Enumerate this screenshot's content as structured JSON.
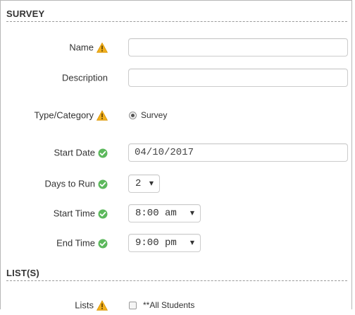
{
  "colors": {
    "warning": "#f2b01e",
    "ok": "#5cb85c",
    "border": "#cccccc"
  },
  "survey_section": {
    "title": "SURVEY",
    "name": {
      "label": "Name",
      "icon": "warning-icon",
      "value": ""
    },
    "description": {
      "label": "Description",
      "value": ""
    },
    "type": {
      "label": "Type/Category",
      "icon": "warning-icon",
      "option_label": "Survey",
      "selected": true
    },
    "start_date": {
      "label": "Start Date",
      "icon": "check-circle-icon",
      "value": "04/10/2017"
    },
    "days_to_run": {
      "label": "Days to Run",
      "icon": "check-circle-icon",
      "value": "2"
    },
    "start_time": {
      "label": "Start Time",
      "icon": "check-circle-icon",
      "value": "8:00 am"
    },
    "end_time": {
      "label": "End Time",
      "icon": "check-circle-icon",
      "value": "9:00 pm"
    }
  },
  "lists_section": {
    "title": "LIST(S)",
    "lists": {
      "label": "Lists",
      "icon": "warning-icon",
      "option_label": "**All Students",
      "checked": false
    }
  }
}
